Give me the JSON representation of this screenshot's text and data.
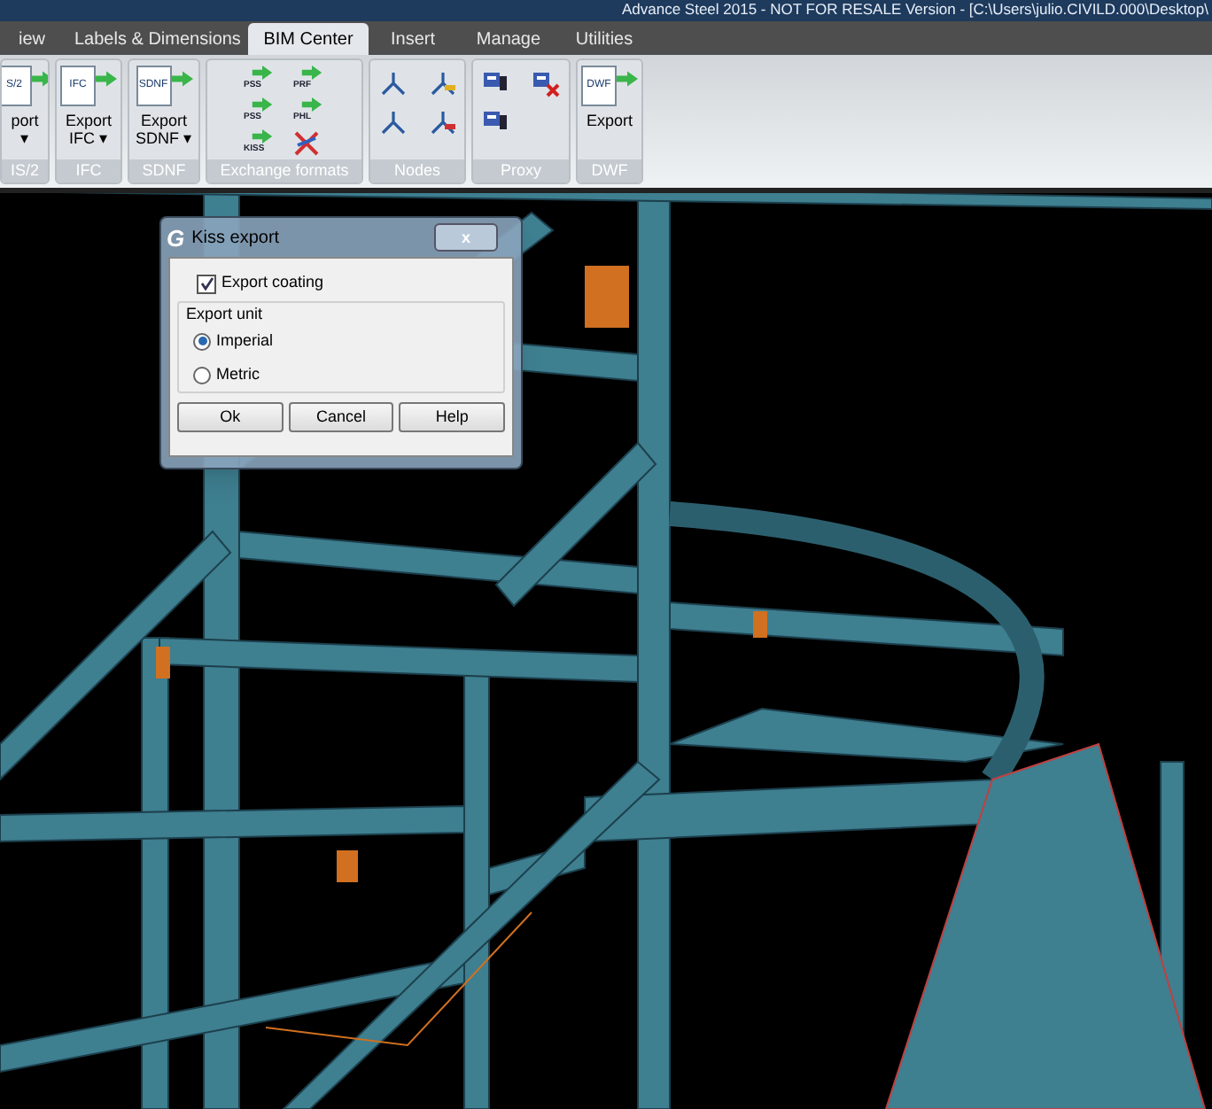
{
  "window": {
    "title": "Advance Steel 2015 - NOT FOR RESALE Version - [C:\\Users\\julio.CIVILD.000\\Desktop\\"
  },
  "tabs": [
    {
      "label": "iew",
      "selected": false
    },
    {
      "label": "Labels & Dimensions",
      "selected": false
    },
    {
      "label": "BIM Center",
      "selected": true
    },
    {
      "label": "Insert",
      "selected": false
    },
    {
      "label": "Manage",
      "selected": false
    },
    {
      "label": "Utilities",
      "selected": false
    }
  ],
  "ribbon_groups": [
    {
      "label": "IS/2",
      "kind": "large",
      "buttons": [
        {
          "lines": [
            "port",
            "▾"
          ],
          "icon_text": "S/2"
        }
      ]
    },
    {
      "label": "IFC",
      "kind": "large",
      "buttons": [
        {
          "lines": [
            "Export",
            "IFC ▾"
          ],
          "icon_text": "IFC"
        }
      ]
    },
    {
      "label": "SDNF",
      "kind": "large",
      "buttons": [
        {
          "lines": [
            "Export",
            "SDNF ▾"
          ],
          "icon_text": "SDNF"
        }
      ]
    },
    {
      "label": "Exchange formats",
      "kind": "small",
      "buttons": [
        {
          "kind": "arrow",
          "icon_text": "PSS"
        },
        {
          "kind": "arrow",
          "icon_text": "PRF"
        },
        {
          "kind": "arrow",
          "icon_text": "PSS"
        },
        {
          "kind": "arrow",
          "icon_text": "PHL"
        },
        {
          "kind": "arrow",
          "icon_text": "KISS"
        },
        {
          "kind": "blocked"
        }
      ]
    },
    {
      "label": "Nodes",
      "kind": "nodes"
    },
    {
      "label": "Proxy",
      "kind": "proxy"
    },
    {
      "label": "DWF",
      "kind": "large",
      "buttons": [
        {
          "lines": [
            "Export"
          ],
          "icon_text": "DWF"
        }
      ]
    }
  ],
  "dialog": {
    "logo": "G",
    "title": "Kiss export",
    "close": "x",
    "checkbox": {
      "label": "Export coating",
      "checked": true
    },
    "group_label": "Export unit",
    "options": [
      {
        "label": "Imperial",
        "selected": true
      },
      {
        "label": "Metric",
        "selected": false
      }
    ],
    "buttons": [
      "Ok",
      "Cancel",
      "Help"
    ]
  }
}
